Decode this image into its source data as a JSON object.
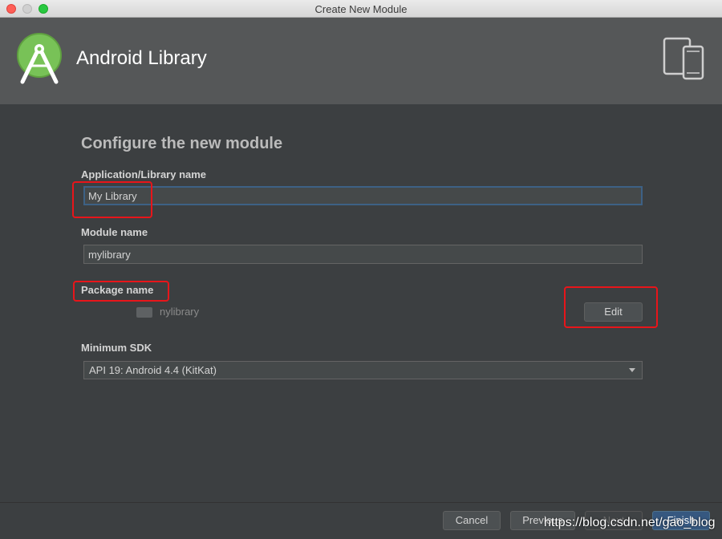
{
  "window": {
    "title": "Create New Module"
  },
  "header": {
    "title": "Android Library"
  },
  "form": {
    "heading": "Configure the new module",
    "app_name": {
      "label": "Application/Library name",
      "value": "My Library"
    },
    "module_name": {
      "label": "Module name",
      "value": "mylibrary"
    },
    "package_name": {
      "label": "Package name",
      "value": "nylibrary",
      "edit_label": "Edit"
    },
    "min_sdk": {
      "label": "Minimum SDK",
      "value": "API 19: Android 4.4 (KitKat)"
    }
  },
  "footer": {
    "cancel_label": "Cancel",
    "previous_label": "Previous",
    "next_label": "Next",
    "finish_label": "Finish"
  },
  "watermark": "https://blog.csdn.net/gao_blog",
  "colors": {
    "background": "#3c3f41",
    "header_bg": "#555758",
    "accent_blue": "#365880",
    "highlight_red": "#e8151a",
    "android_green": "#78c257"
  }
}
